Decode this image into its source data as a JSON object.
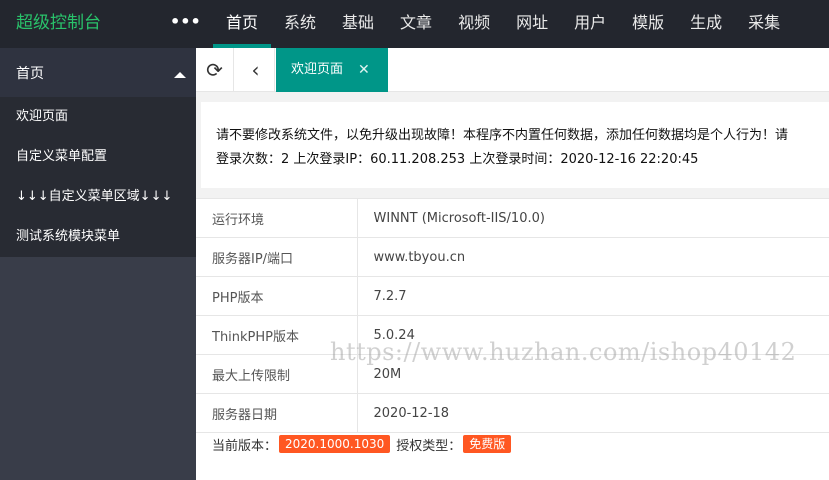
{
  "app": {
    "logo_text": "超级控制台",
    "more_label": "•••"
  },
  "topnav": [
    {
      "label": "首页",
      "active": true
    },
    {
      "label": "系统"
    },
    {
      "label": "基础"
    },
    {
      "label": "文章"
    },
    {
      "label": "视频"
    },
    {
      "label": "网址"
    },
    {
      "label": "用户"
    },
    {
      "label": "模版"
    },
    {
      "label": "生成"
    },
    {
      "label": "采集"
    }
  ],
  "sidebar": {
    "head_label": "首页",
    "items": [
      {
        "label": "欢迎页面"
      },
      {
        "label": "自定义菜单配置"
      },
      {
        "label": "↓↓↓自定义菜单区域↓↓↓"
      },
      {
        "label": "测试系统模块菜单"
      }
    ]
  },
  "tabbar": {
    "refresh_icon": "⟳",
    "back_icon": "‹",
    "active_tab": "欢迎页面",
    "close_icon": "✕"
  },
  "notice": {
    "line1": "请不要修改系统文件，以免升级出现故障！本程序不内置任何数据，添加任何数据均是个人行为！请",
    "line2": "登录次数：2 上次登录IP：60.11.208.253 上次登录时间：2020-12-16 22:20:45"
  },
  "info_rows": [
    {
      "key": "运行环境",
      "value": "WINNT (Microsoft-IIS/10.0)"
    },
    {
      "key": "服务器IP/端口",
      "value": "www.tbyou.cn"
    },
    {
      "key": "PHP版本",
      "value": "7.2.7"
    },
    {
      "key": "ThinkPHP版本",
      "value": "5.0.24"
    },
    {
      "key": "最大上传限制",
      "value": "20M"
    },
    {
      "key": "服务器日期",
      "value": "2020-12-18"
    }
  ],
  "version": {
    "current_label": "当前版本：",
    "current_value": "2020.1000.1030",
    "license_label": "授权类型：",
    "license_value": "免费版"
  },
  "watermark": "https://www.huzhan.com/ishop40142",
  "colors": {
    "topbar_bg": "#23262e",
    "logo_green": "#29c36b",
    "accent_teal": "#009688",
    "sidebar_bg": "#393d49",
    "sidebar_sub_bg": "#282b33",
    "badge_orange": "#ff5722"
  }
}
